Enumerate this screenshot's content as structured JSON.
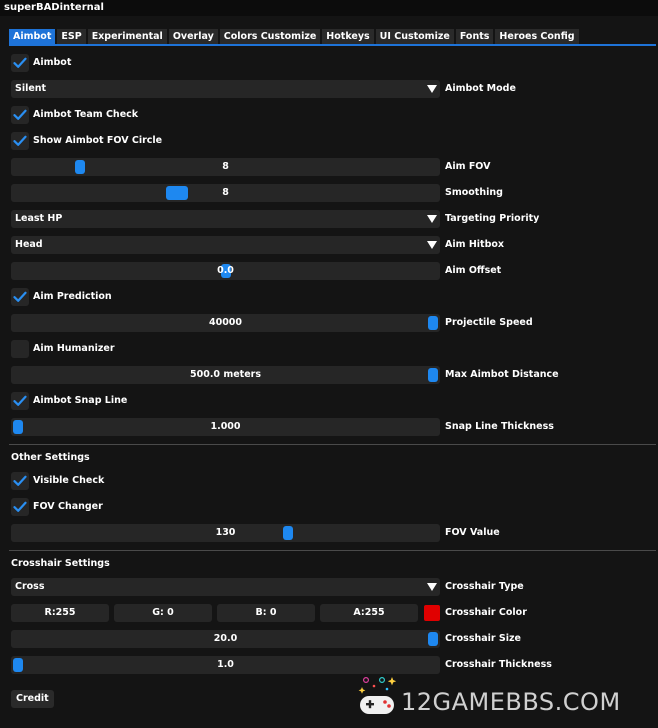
{
  "window": {
    "title": "superBADinternal"
  },
  "tabs": [
    {
      "label": "Aimbot",
      "active": true
    },
    {
      "label": "ESP"
    },
    {
      "label": "Experimental"
    },
    {
      "label": "Overlay"
    },
    {
      "label": "Colors Customize"
    },
    {
      "label": "Hotkeys"
    },
    {
      "label": "UI Customize"
    },
    {
      "label": "Fonts"
    },
    {
      "label": "Heroes Config"
    }
  ],
  "aimbot": {
    "aimbot": {
      "label": "Aimbot",
      "checked": true
    },
    "mode": {
      "value": "Silent",
      "label": "Aimbot Mode"
    },
    "team_check": {
      "label": "Aimbot Team Check",
      "checked": true
    },
    "fov_circle": {
      "label": "Show Aimbot FOV Circle",
      "checked": true
    },
    "aim_fov": {
      "value": "8",
      "label": "Aim FOV",
      "fraction": 0.15
    },
    "smoothing": {
      "value": "8",
      "label": "Smoothing",
      "fraction": 0.38
    },
    "priority": {
      "value": "Least HP",
      "label": "Targeting Priority"
    },
    "hitbox": {
      "value": "Head",
      "label": "Aim Hitbox"
    },
    "offset": {
      "value": "0.0",
      "label": "Aim Offset",
      "fraction": 0.5
    },
    "prediction": {
      "label": "Aim Prediction",
      "checked": true
    },
    "projectile_speed": {
      "value": "40000",
      "label": "Projectile Speed",
      "fraction": 1.0
    },
    "humanizer": {
      "label": "Aim Humanizer",
      "checked": false
    },
    "max_distance": {
      "value": "500.0 meters",
      "label": "Max Aimbot Distance",
      "fraction": 1.0
    },
    "snap_line": {
      "label": "Aimbot Snap Line",
      "checked": true
    },
    "snap_thickness": {
      "value": "1.000",
      "label": "Snap Line Thickness",
      "fraction": 0.0
    }
  },
  "other": {
    "title": "Other Settings",
    "visible_check": {
      "label": "Visible Check",
      "checked": true
    },
    "fov_changer": {
      "label": "FOV Changer",
      "checked": true
    },
    "fov_value": {
      "value": "130",
      "label": "FOV Value",
      "fraction": 0.65
    }
  },
  "crosshair": {
    "title": "Crosshair Settings",
    "type": {
      "value": "Cross",
      "label": "Crosshair Type"
    },
    "color": {
      "r": "R:255",
      "g": "G:  0",
      "b": "B:  0",
      "a": "A:255",
      "label": "Crosshair Color",
      "swatch": "#e00000"
    },
    "size": {
      "value": "20.0",
      "label": "Crosshair Size",
      "fraction": 1.0
    },
    "thickness": {
      "value": "1.0",
      "label": "Crosshair Thickness",
      "fraction": 0.0
    }
  },
  "footer": {
    "credit_label": "Credit"
  },
  "watermark": {
    "text": "12GAMEBBS.COM"
  },
  "colors": {
    "accent": "#1e73d8",
    "grab": "#1e88f0",
    "frame": "#262626"
  }
}
